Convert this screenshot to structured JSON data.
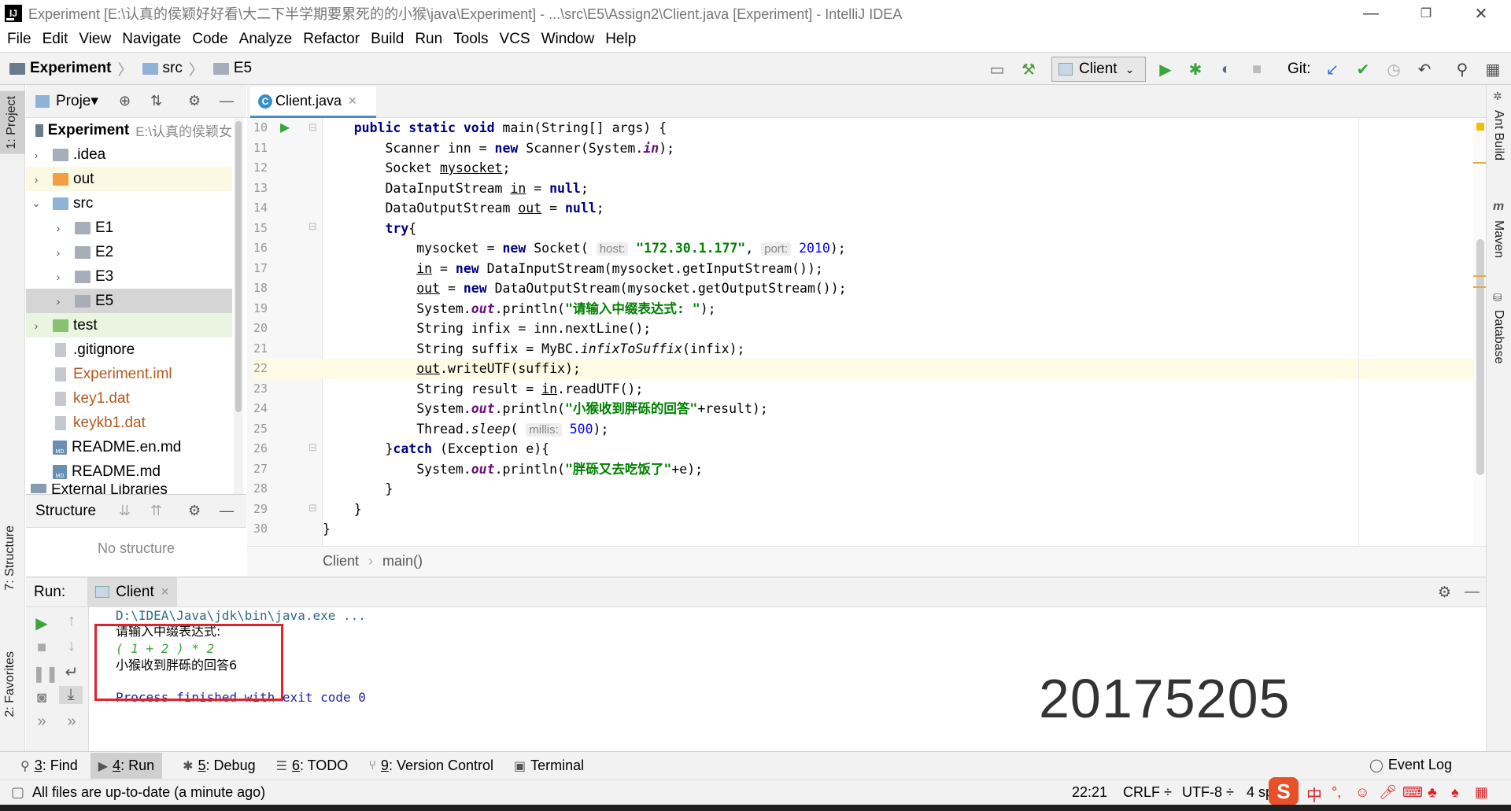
{
  "window": {
    "title": "Experiment [E:\\认真的侯颖好好看\\大二下半学期要累死的的小猴\\java\\Experiment] - ...\\src\\E5\\Assign2\\Client.java [Experiment] - IntelliJ IDEA",
    "minimize": "—",
    "restore": "❐",
    "close": "✕"
  },
  "menu": [
    "File",
    "Edit",
    "View",
    "Navigate",
    "Code",
    "Analyze",
    "Refactor",
    "Build",
    "Run",
    "Tools",
    "VCS",
    "Window",
    "Help"
  ],
  "breadcrumb": {
    "project": "Experiment",
    "folder1": "src",
    "folder2": "E5"
  },
  "toolbar": {
    "run_config": "Client",
    "git_label": "Git:"
  },
  "left_stripe": {
    "project_tab": "1: Project",
    "structure_tab": "7: Structure",
    "favorites_tab": "2: Favorites"
  },
  "right_stripe": {
    "ant": "Ant Build",
    "maven": "Maven",
    "database": "Database"
  },
  "project_panel": {
    "title": "Proje▾",
    "root": "Experiment",
    "root_path": "E:\\认真的侯颖女",
    "items": [
      {
        "label": ".idea",
        "color": "#000000"
      },
      {
        "label": "out",
        "color": "#000000"
      },
      {
        "label": "src",
        "color": "#000000"
      },
      {
        "label": "E1",
        "color": "#000000"
      },
      {
        "label": "E2",
        "color": "#000000"
      },
      {
        "label": "E3",
        "color": "#000000"
      },
      {
        "label": "E5",
        "color": "#000000"
      },
      {
        "label": "test",
        "color": "#000000"
      },
      {
        "label": ".gitignore",
        "color": "#000000"
      },
      {
        "label": "Experiment.iml",
        "color": "#b5581e"
      },
      {
        "label": "key1.dat",
        "color": "#b5581e"
      },
      {
        "label": "keykb1.dat",
        "color": "#b5581e"
      },
      {
        "label": "README.en.md",
        "color": "#000000"
      },
      {
        "label": "README.md",
        "color": "#000000"
      },
      {
        "label": "External Libraries",
        "color": "#000000"
      }
    ]
  },
  "structure_panel": {
    "title": "Structure",
    "empty_text": "No structure"
  },
  "editor": {
    "tab": "Client.java",
    "current_line": 22,
    "line_numbers": [
      "10",
      "11",
      "12",
      "13",
      "14",
      "15",
      "16",
      "17",
      "18",
      "19",
      "20",
      "21",
      "22",
      "23",
      "24",
      "25",
      "26",
      "27",
      "28",
      "29",
      "30"
    ],
    "hints": {
      "host": "host:",
      "port": "port:",
      "millis": "millis:"
    },
    "strings": {
      "ip": "\"172.30.1.177\"",
      "prompt": "\"请输入中缀表达式: \"",
      "received": "\"小猴收到胖砾的回答\"",
      "error": "\"胖砾又去吃饭了\""
    },
    "numbers": {
      "port": "2010",
      "sleep": "500"
    },
    "breadcrumb_class": "Client",
    "breadcrumb_method": "main()"
  },
  "run_panel": {
    "label": "Run:",
    "tab": "Client",
    "console": {
      "cmd": "D:\\IDEA\\Java\\jdk\\bin\\java.exe ...",
      "prompt": "请输入中缀表达式:",
      "input": "( 1 + 2 ) * 2",
      "result": "小猴收到胖砾的回答6",
      "finished": "Process finished with exit code 0"
    },
    "overlay_number": "20175205"
  },
  "bottom_tabs": [
    {
      "key": "3",
      "label": ": Find",
      "icon": "⚲"
    },
    {
      "key": "4",
      "label": ": Run",
      "icon": "▶"
    },
    {
      "key": "5",
      "label": ": Debug",
      "icon": "✱"
    },
    {
      "key": "6",
      "label": ": TODO",
      "icon": "☰"
    },
    {
      "key": "9",
      "label": ": Version Control",
      "icon": "⑂"
    },
    {
      "key": "",
      "label": "Terminal",
      "icon": "▣"
    }
  ],
  "event_log": "Event Log",
  "status": {
    "message": "All files are up-to-date (a minute ago)",
    "position": "22:21",
    "line_sep": "CRLF ÷",
    "encoding": "UTF-8 ÷",
    "indent": "4 sp",
    "ime_label": "中"
  }
}
